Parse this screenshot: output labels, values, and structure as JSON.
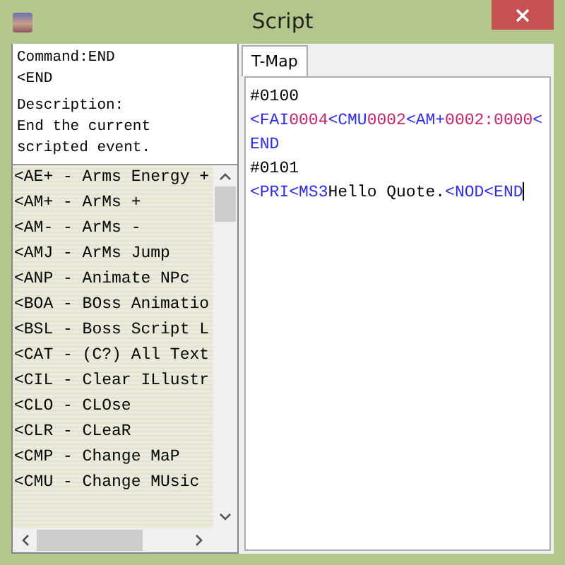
{
  "window": {
    "title": "Script"
  },
  "command_info": {
    "command": "Command:END",
    "syntax": "<END",
    "description_label": "Description:",
    "description": "End the current scripted event."
  },
  "command_list": [
    {
      "label": "<AE+ - Arms Energy +"
    },
    {
      "label": "<AM+ - ArMs +"
    },
    {
      "label": "<AM- - ArMs -"
    },
    {
      "label": "<AMJ - ArMs Jump"
    },
    {
      "label": "<ANP - Animate NPc"
    },
    {
      "label": "<BOA - BOss Animatio"
    },
    {
      "label": "<BSL - Boss Script L"
    },
    {
      "label": "<CAT - (C?) All Text"
    },
    {
      "label": "<CIL - Clear ILlustr"
    },
    {
      "label": "<CLO - CLOse"
    },
    {
      "label": "<CLR - CLeaR"
    },
    {
      "label": "<CMP - Change MaP"
    },
    {
      "label": "<CMU - Change MUsic"
    }
  ],
  "tabs": [
    {
      "label": "T-Map",
      "selected": true
    }
  ],
  "editor": {
    "lines": [
      [
        {
          "kind": "event",
          "text": "#0100"
        }
      ],
      [
        {
          "kind": "tag",
          "text": "<FAI"
        },
        {
          "kind": "num",
          "text": "0004"
        },
        {
          "kind": "tag",
          "text": "<CMU"
        },
        {
          "kind": "num",
          "text": "0002"
        },
        {
          "kind": "tag",
          "text": "<AM+"
        },
        {
          "kind": "num",
          "text": "0002:0000"
        },
        {
          "kind": "tag",
          "text": "<"
        }
      ],
      [
        {
          "kind": "tag",
          "text": "END"
        }
      ],
      [
        {
          "kind": "event",
          "text": "#0101"
        }
      ],
      [
        {
          "kind": "tag",
          "text": "<PRI"
        },
        {
          "kind": "tag",
          "text": "<MS3"
        },
        {
          "kind": "text",
          "text": "Hello Quote."
        },
        {
          "kind": "tag",
          "text": "<NOD"
        },
        {
          "kind": "tag",
          "text": "<END"
        }
      ]
    ]
  }
}
